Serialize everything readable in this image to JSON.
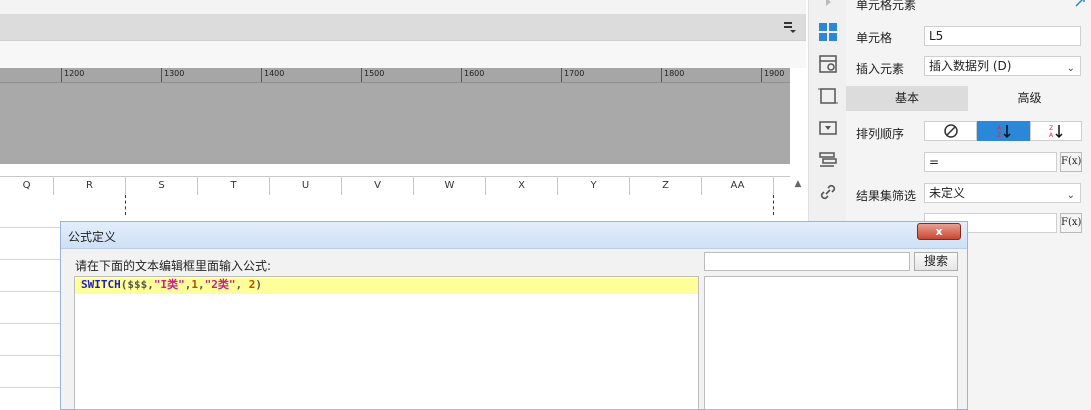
{
  "ruler": {
    "marks": [
      "1200",
      "1300",
      "1400",
      "1500",
      "1600",
      "1700",
      "1800",
      "1900"
    ]
  },
  "columns": [
    "Q",
    "R",
    "S",
    "T",
    "U",
    "V",
    "W",
    "X",
    "Y",
    "Z",
    "AA"
  ],
  "panel": {
    "header": "单元格元素",
    "cell_label": "单元格",
    "cell_value": "L5",
    "insert_label": "插入元素",
    "insert_value": "插入数据列 (D)",
    "tabs": {
      "basic": "基本",
      "advanced": "高级"
    },
    "sort_label": "排列顺序",
    "sort_options": [
      "none",
      "ascending",
      "descending"
    ],
    "sort_expr_value": "=",
    "filter_label": "结果集筛选",
    "filter_value": "未定义",
    "fx_label": "F(x)"
  },
  "dialog": {
    "title": "公式定义",
    "close_label": "x",
    "instruction": "请在下面的文本编辑框里面输入公式:",
    "formula": {
      "fn": "SWITCH",
      "open": "(",
      "arg1": "$$$",
      "s1": "\"I类\"",
      "n1": "1",
      "s2": "\"2类\"",
      "n2": "2",
      "close": ")"
    },
    "search_button": "搜索",
    "search_value": ""
  },
  "colors": {
    "accent": "#2b88d8",
    "sort_active": "#2b88d8",
    "editor_highlight": "#ffff99",
    "close_button": "#c9472f"
  }
}
